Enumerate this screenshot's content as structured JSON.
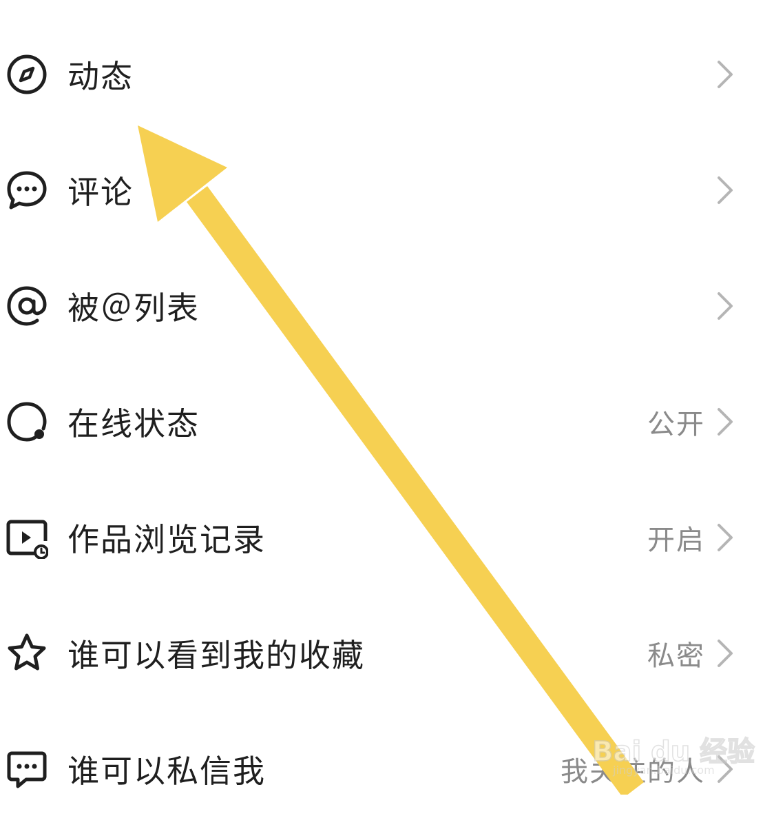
{
  "settings": {
    "items": [
      {
        "id": "dynamics",
        "label": "动态",
        "value": "",
        "icon": "compass-icon"
      },
      {
        "id": "comments",
        "label": "评论",
        "value": "",
        "icon": "chat-bubble-icon"
      },
      {
        "id": "mentions",
        "label": "被＠列表",
        "value": "",
        "icon": "at-sign-icon"
      },
      {
        "id": "online-status",
        "label": "在线状态",
        "value": "公开",
        "icon": "online-status-icon"
      },
      {
        "id": "view-history",
        "label": "作品浏览记录",
        "value": "开启",
        "icon": "video-history-icon"
      },
      {
        "id": "favorites-visibility",
        "label": "谁可以看到我的收藏",
        "value": "私密",
        "icon": "star-icon"
      },
      {
        "id": "who-can-message",
        "label": "谁可以私信我",
        "value": "我关注的人",
        "icon": "message-icon"
      }
    ]
  },
  "annotation": {
    "arrow_color": "#F6D052",
    "points_to": "动态"
  },
  "watermark": {
    "text": "Bai du 经验",
    "sub": "jingyan.baidu.com"
  },
  "colors": {
    "label": "#1f1f1f",
    "value": "#8a8a8a",
    "chevron": "#b5b5b5",
    "icon": "#1f1f1f",
    "background": "#ffffff"
  }
}
